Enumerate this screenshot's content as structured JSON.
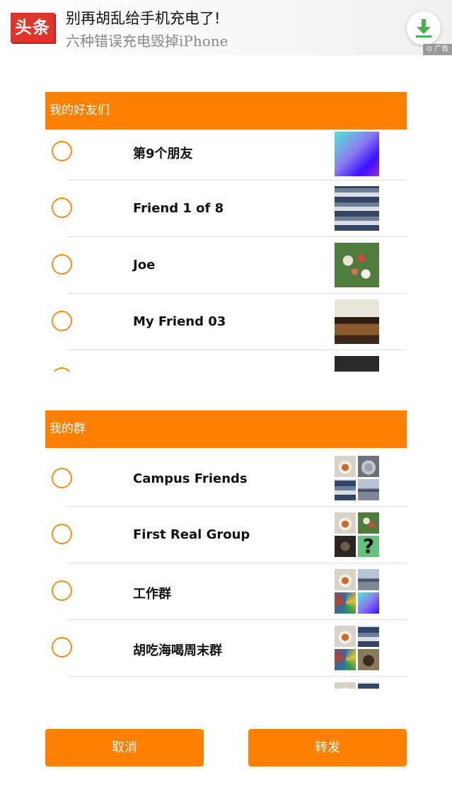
{
  "ad": {
    "logo": "头条",
    "title": "别再胡乱给手机充电了!",
    "subtitle": "六种错误充电毁掉iPhone",
    "tag": "广告",
    "icon": "download-icon"
  },
  "friends": {
    "header": "我的好友们",
    "items": [
      {
        "name": "第9个朋友"
      },
      {
        "name": "Friend 1 of 8"
      },
      {
        "name": "Joe"
      },
      {
        "name": "My Friend 03"
      }
    ]
  },
  "groups": {
    "header": "我的群",
    "items": [
      {
        "name": "Campus Friends"
      },
      {
        "name": "First Real Group"
      },
      {
        "name": "工作群"
      },
      {
        "name": "胡吃海喝周末群"
      }
    ]
  },
  "footer": {
    "cancel": "取消",
    "forward": "转发"
  },
  "colors": {
    "accent": "#ff7f00",
    "radio_border": "#ff8a1a"
  }
}
